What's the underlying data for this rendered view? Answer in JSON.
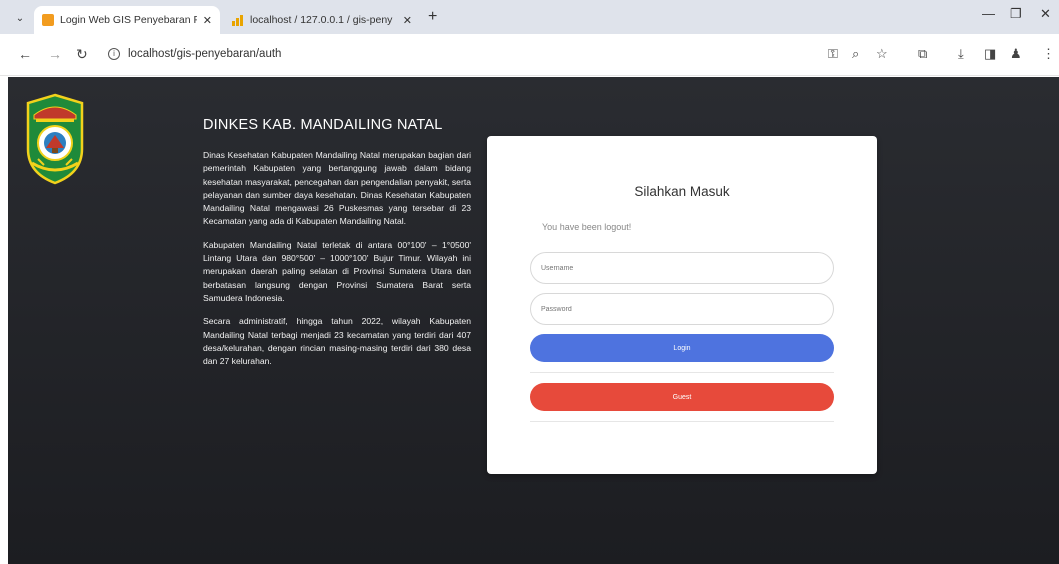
{
  "browser": {
    "tabs": [
      {
        "title": "Login Web GIS Penyebaran Pen",
        "active": true
      },
      {
        "title": "localhost / 127.0.0.1 / gis-peny",
        "active": false
      }
    ],
    "url": "localhost/gis-penyebaran/auth",
    "close_glyph": "✕",
    "new_tab_glyph": "+"
  },
  "info": {
    "title": "DINKES KAB. MANDAILING NATAL",
    "paragraphs": [
      "Dinas Kesehatan Kabupaten Mandailing Natal merupakan bagian dari pemerintah Kabupaten yang bertanggung jawab dalam bidang kesehatan masyarakat, pencegahan dan pengendalian penyakit, serta pelayanan dan sumber daya kesehatan. Dinas Kesehatan Kabupaten Mandailing Natal mengawasi 26 Puskesmas yang tersebar di 23 Kecamatan yang ada di Kabupaten Mandailing Natal.",
      "Kabupaten Mandailing Natal terletak di antara 00°100' – 1°0500' Lintang Utara dan 980°500' – 1000°100' Bujur Timur. Wilayah ini merupakan daerah paling selatan di Provinsi Sumatera Utara dan berbatasan langsung dengan Provinsi Sumatera Barat serta Samudera Indonesia.",
      "Secara administratif, hingga tahun 2022, wilayah Kabupaten Mandailing Natal terbagi menjadi 23 kecamatan yang terdiri dari 407 desa/kelurahan, dengan rincian masing-masing terdiri dari 380 desa dan 27 kelurahan."
    ]
  },
  "login": {
    "title": "Silahkan Masuk",
    "message": "You have been logout!",
    "username_placeholder": "Username",
    "password_placeholder": "Password",
    "login_label": "Login",
    "guest_label": "Guest"
  },
  "colors": {
    "login_button": "#4e73df",
    "guest_button": "#e74a3b",
    "page_background": "#232428"
  }
}
